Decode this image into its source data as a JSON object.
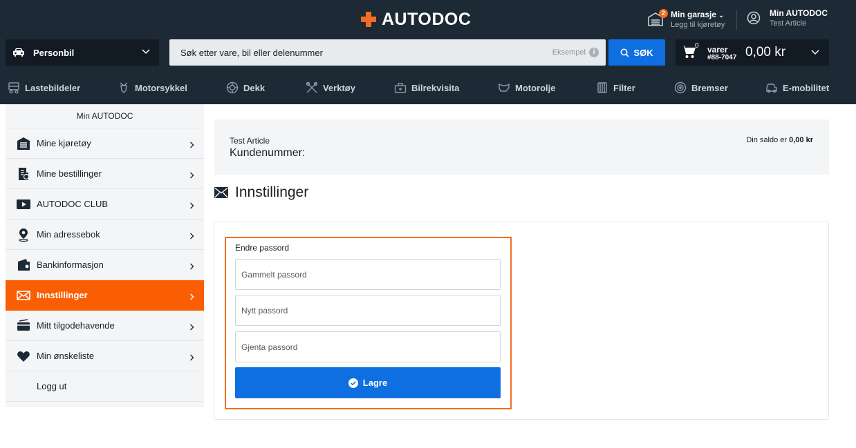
{
  "header": {
    "logo_text": "AUTODOC",
    "garage": {
      "badge": "2",
      "title": "Min garasje",
      "subtitle": "Legg til kjøretøy"
    },
    "account": {
      "title": "Min AUTODOC",
      "subtitle": "Test Article"
    },
    "vehicle_type": "Personbil",
    "search": {
      "placeholder": "Søk etter vare, bil eller delenummer",
      "example_label": "Eksempel",
      "button_label": "SØK"
    },
    "cart": {
      "count": "0",
      "label": "varer",
      "number": "#88-7047",
      "total": "0,00 kr"
    }
  },
  "nav": {
    "items": [
      {
        "label": "Lastebildeler",
        "icon": "truck-icon"
      },
      {
        "label": "Motorsykkel",
        "icon": "motorcycle-icon"
      },
      {
        "label": "Dekk",
        "icon": "tire-icon"
      },
      {
        "label": "Verktøy",
        "icon": "tools-icon"
      },
      {
        "label": "Bilrekvisita",
        "icon": "car-accessories-icon"
      },
      {
        "label": "Motorolje",
        "icon": "oil-can-icon"
      },
      {
        "label": "Filter",
        "icon": "filter-icon"
      },
      {
        "label": "Bremser",
        "icon": "brake-disc-icon"
      },
      {
        "label": "E-mobilitet",
        "icon": "electric-car-icon"
      }
    ]
  },
  "sidebar": {
    "title": "Min AUTODOC",
    "items": [
      {
        "label": "Mine kjøretøy",
        "icon": "garage-icon"
      },
      {
        "label": "Mine bestillinger",
        "icon": "orders-icon"
      },
      {
        "label": "AUTODOC CLUB",
        "icon": "play-icon"
      },
      {
        "label": "Min adressebok",
        "icon": "location-pin-icon"
      },
      {
        "label": "Bankinformasjon",
        "icon": "wallet-icon"
      },
      {
        "label": "Innstillinger",
        "icon": "envelope-icon"
      },
      {
        "label": "Mitt tilgodehavende",
        "icon": "credit-card-icon"
      },
      {
        "label": "Min ønskeliste",
        "icon": "heart-icon"
      }
    ],
    "logout_label": "Logg ut"
  },
  "customer": {
    "name": "Test Article",
    "number_label": "Kundenummer:",
    "balance_prefix": "Din saldo er",
    "balance_value": "0,00 kr"
  },
  "page": {
    "title": "Innstillinger"
  },
  "password_form": {
    "title": "Endre passord",
    "old_placeholder": "Gammelt passord",
    "new_placeholder": "Nytt passord",
    "repeat_placeholder": "Gjenta passord",
    "save_label": "Lagre"
  },
  "colors": {
    "header_bg": "#1d2a36",
    "accent": "#f36c21",
    "active_item": "#f95e04",
    "primary_button": "#0f6fe0"
  }
}
